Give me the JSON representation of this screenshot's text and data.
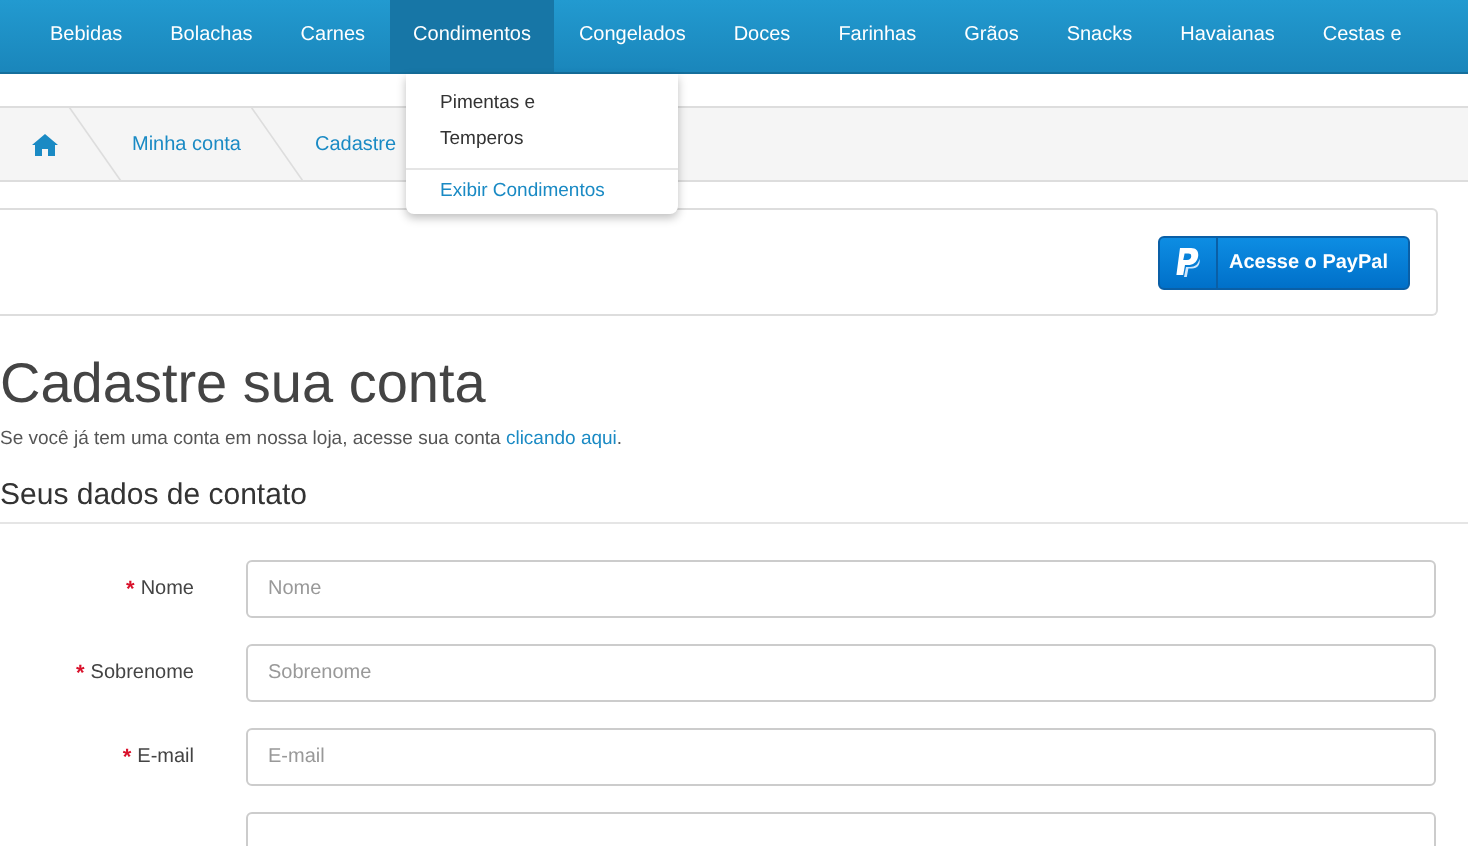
{
  "nav": [
    {
      "label": "Bebidas",
      "selected": false
    },
    {
      "label": "Bolachas",
      "selected": false
    },
    {
      "label": "Carnes",
      "selected": false
    },
    {
      "label": "Condimentos",
      "selected": true
    },
    {
      "label": "Congelados",
      "selected": false
    },
    {
      "label": "Doces",
      "selected": false
    },
    {
      "label": "Farinhas",
      "selected": false
    },
    {
      "label": "Grãos",
      "selected": false
    },
    {
      "label": "Snacks",
      "selected": false
    },
    {
      "label": "Havaianas",
      "selected": false
    },
    {
      "label": "Cestas e",
      "selected": false
    }
  ],
  "dropdown": {
    "items": [
      "Pimentas e Temperos"
    ],
    "footer_link": "Exibir Condimentos"
  },
  "breadcrumb": [
    "Minha conta",
    "Cadastre"
  ],
  "paypal_button": "Acesse o PayPal",
  "title": "Cadastre sua conta",
  "intro": {
    "text": "Se você já tem uma conta em nossa loja, acesse sua conta ",
    "link": "clicando aqui",
    "after": "."
  },
  "section_title": "Seus dados de contato",
  "required_mark": "*",
  "fields": [
    {
      "kind": "text",
      "label": "Nome",
      "placeholder": "Nome",
      "required": true
    },
    {
      "kind": "text",
      "label": "Sobrenome",
      "placeholder": "Sobrenome",
      "required": true
    },
    {
      "kind": "text",
      "label": "E-mail",
      "placeholder": "E-mail",
      "required": true
    },
    {
      "kind": "cut"
    }
  ]
}
